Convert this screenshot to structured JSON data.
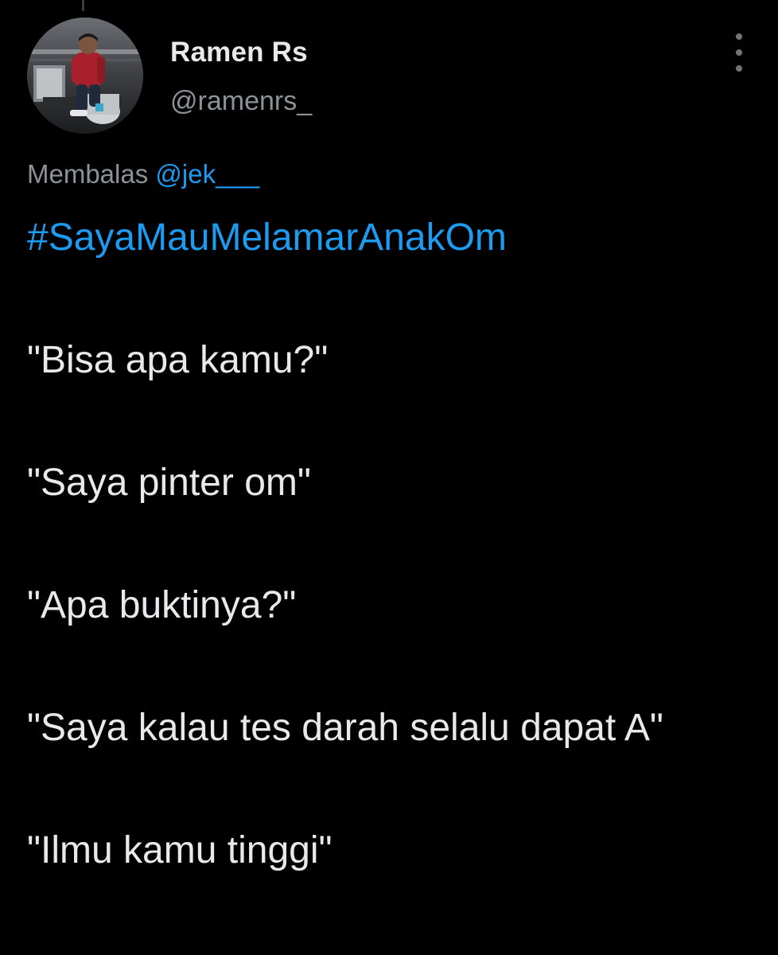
{
  "tweet": {
    "author": {
      "name": "Ramen Rs",
      "handle": "@ramenrs_"
    },
    "reply": {
      "prefix": "Membalas",
      "mention": "@jek___"
    },
    "hashtag": "#SayaMauMelamarAnakOm",
    "lines": [
      "\"Bisa apa kamu?\"",
      "\"Saya pinter om\"",
      "\"Apa buktinya?\"",
      "\"Saya kalau tes darah selalu dapat A\"",
      "\"Ilmu kamu tinggi\""
    ]
  },
  "colors": {
    "background": "#000000",
    "text": "#e7e9ea",
    "muted": "#8b9298",
    "accent": "#1d9bf0"
  },
  "icons": {
    "more": "more-vertical-icon"
  }
}
